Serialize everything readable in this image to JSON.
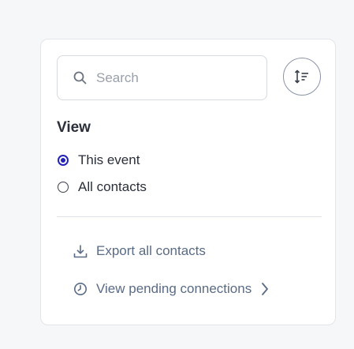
{
  "search": {
    "placeholder": "Search",
    "value": ""
  },
  "icons": {
    "search": "search-icon",
    "sort": "sort-icon",
    "export": "download-icon",
    "pending": "clock-icon",
    "chevron": "chevron-right-icon"
  },
  "view": {
    "title": "View",
    "options": [
      {
        "label": "This event",
        "selected": true
      },
      {
        "label": "All contacts",
        "selected": false
      }
    ]
  },
  "actions": {
    "export_label": "Export all contacts",
    "pending_label": "View pending connections"
  },
  "colors": {
    "accent": "#2323b8",
    "link": "#5a6b86",
    "text": "#2b2f3a",
    "border": "#d7dae0",
    "background": "#f6f7f9"
  }
}
